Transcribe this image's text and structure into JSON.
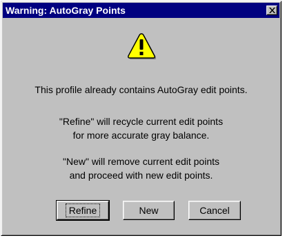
{
  "dialog": {
    "title": "Warning: AutoGray Points",
    "icon": "warning-icon",
    "message1": "This profile already contains AutoGray edit points.",
    "message2_line1": "\"Refine\" will recycle current edit points",
    "message2_line2": "for more accurate gray balance.",
    "message3_line1": "\"New\" will remove current edit points",
    "message3_line2": "and proceed with new edit points."
  },
  "buttons": {
    "refine": "Refine",
    "new": "New",
    "cancel": "Cancel"
  },
  "colors": {
    "titlebar": "#000080",
    "face": "#c0c0c0",
    "warning_yellow": "#ffff00"
  }
}
